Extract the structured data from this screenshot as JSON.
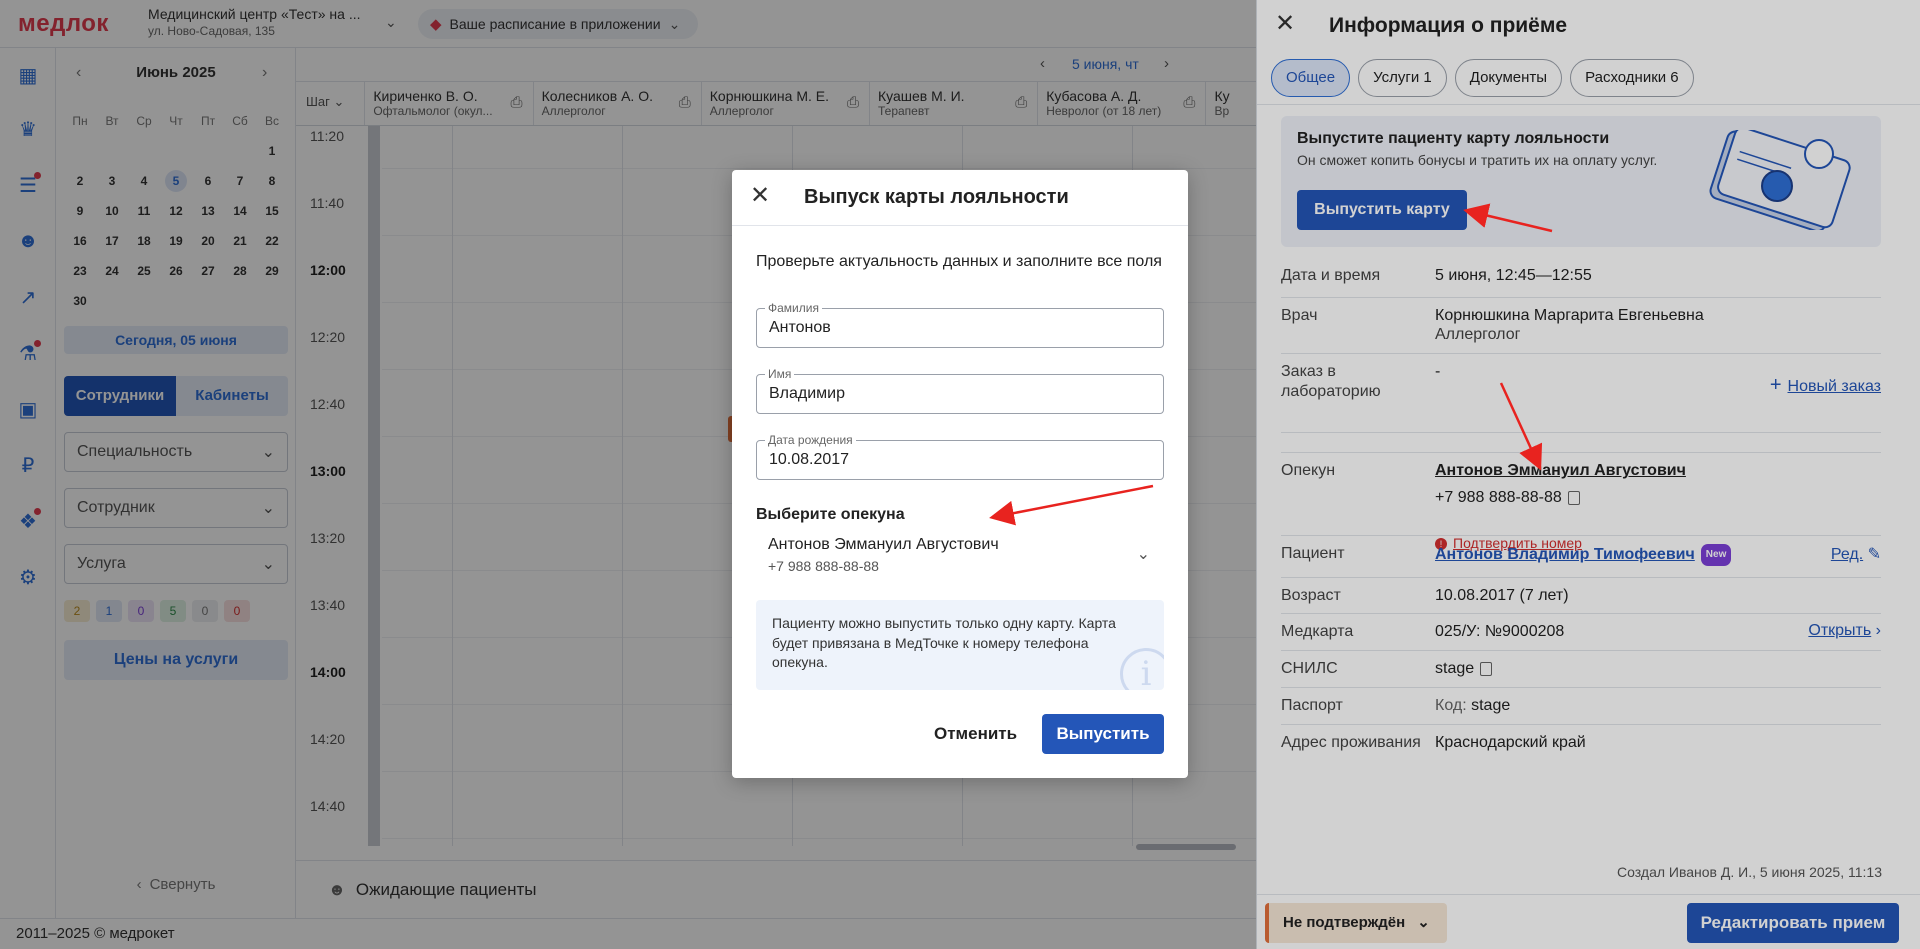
{
  "topbar": {
    "logo": "медлок",
    "clinic_name": "Медицинский центр «Тест» на ...",
    "clinic_address": "ул. Ново-Садовая, 135",
    "promo": "Ваше расписание в приложении"
  },
  "calendar": {
    "month": "Июнь 2025",
    "weekdays": [
      "Пн",
      "Вт",
      "Ср",
      "Чт",
      "Пт",
      "Сб",
      "Вс"
    ],
    "days": [
      "",
      "",
      "",
      "",
      "",
      "",
      "1",
      "2",
      "3",
      "4",
      "5",
      "6",
      "7",
      "8",
      "9",
      "10",
      "11",
      "12",
      "13",
      "14",
      "15",
      "16",
      "17",
      "18",
      "19",
      "20",
      "21",
      "22",
      "23",
      "24",
      "25",
      "26",
      "27",
      "28",
      "29",
      "30"
    ],
    "selected_day": "5",
    "today_button": "Сегодня, 05 июня",
    "tab_staff": "Сотрудники",
    "tab_rooms": "Кабинеты",
    "filter_specialty": "Специальность",
    "filter_employee": "Сотрудник",
    "filter_service": "Услуга",
    "counters": [
      {
        "value": "2",
        "bg": "#f6ecd3",
        "color": "#b98a1e"
      },
      {
        "value": "1",
        "bg": "#e2e9f7",
        "color": "#2f6fd6"
      },
      {
        "value": "0",
        "bg": "#ece4f7",
        "color": "#7b3fd6"
      },
      {
        "value": "5",
        "bg": "#dff1e3",
        "color": "#2e8b4a"
      },
      {
        "value": "0",
        "bg": "#eceef1",
        "color": "#777777"
      },
      {
        "value": "0",
        "bg": "#f9e1e1",
        "color": "#d32f2f"
      }
    ],
    "prices_button": "Цены на услуги",
    "collapse": "Свернуть"
  },
  "schedule": {
    "date": "5 июня, чт",
    "step": "Шаг",
    "doctors": [
      {
        "name": "Кириченко В. О.",
        "spec": "Офтальмолог (окул..."
      },
      {
        "name": "Колесников А. О.",
        "spec": "Аллерголог"
      },
      {
        "name": "Корнюшкина М. Е.",
        "spec": "Аллерголог"
      },
      {
        "name": "Куашев М. И.",
        "spec": "Терапевт"
      },
      {
        "name": "Кубасова А. Д.",
        "spec": "Невролог (от 18 лет)"
      },
      {
        "name": "Ку",
        "spec": "Вр"
      }
    ],
    "times": [
      {
        "t": "11:20",
        "bold": false
      },
      {
        "t": "11:40",
        "bold": false
      },
      {
        "t": "12:00",
        "bold": true
      },
      {
        "t": "12:20",
        "bold": false
      },
      {
        "t": "12:40",
        "bold": false
      },
      {
        "t": "13:00",
        "bold": true
      },
      {
        "t": "13:20",
        "bold": false
      },
      {
        "t": "13:40",
        "bold": false
      },
      {
        "t": "14:00",
        "bold": true
      },
      {
        "t": "14:20",
        "bold": false
      },
      {
        "t": "14:40",
        "bold": false
      }
    ],
    "waiting": "Ожидающие пациенты"
  },
  "footer": "2011–2025 © медрокет",
  "modal": {
    "title": "Выпуск карты лояльности",
    "subtitle": "Проверьте актуальность данных и заполните все поля",
    "surname_label": "Фамилия",
    "surname": "Антонов",
    "name_label": "Имя",
    "name": "Владимир",
    "birth_label": "Дата рождения",
    "birth": "10.08.2017",
    "guardian_title": "Выберите опекуна",
    "guardian_name": "Антонов Эммануил Августович",
    "guardian_phone": "+7 988 888-88-88",
    "info": "Пациенту можно выпустить только одну карту. Карта будет привязана в МедТочке к номеру телефона опекуна.",
    "cancel": "Отменить",
    "issue": "Выпустить"
  },
  "drawer": {
    "title": "Информация о приёме",
    "tabs": [
      "Общее",
      "Услуги 1",
      "Документы",
      "Расходники 6"
    ],
    "loyalty_title": "Выпустите пациенту карту лояльности",
    "loyalty_sub": "Он сможет копить бонусы и тратить их на оплату услуг.",
    "loyalty_button": "Выпустить карту",
    "date_label": "Дата и время",
    "date_value": "5 июня, 12:45—12:55",
    "doctor_label": "Врач",
    "doctor_name": "Корнюшкина Маргарита Евгеньевна",
    "doctor_spec": "Аллерголог",
    "lab_label": "Заказ в лабораторию",
    "lab_value": "-",
    "new_order": "Новый заказ",
    "guardian_label": "Опекун",
    "guardian_name": "Антонов Эммануил Августович",
    "guardian_phone": "+7 988 888-88-88",
    "confirm_phone": "Подтвердить номер",
    "patient_label": "Пациент",
    "patient_name": "Антонов Владимир Тимофеевич",
    "new_badge": "New",
    "edit_link": "Ред.",
    "age_label": "Возраст",
    "age_value": "10.08.2017 (7 лет)",
    "card_label": "Медкарта",
    "card_value": "025/У: №9000208",
    "open_link": "Открыть",
    "snils_label": "СНИЛС",
    "snils_value": "stage",
    "passport_label": "Паспорт",
    "passport_code": "Код:",
    "passport_value": "stage",
    "address_label": "Адрес проживания",
    "address_value": "Краснодарский край",
    "created": "Создал Иванов Д. И., 5 июня 2025, 11:13",
    "status": "Не подтверждён",
    "edit_button": "Редактировать прием"
  },
  "colors": {
    "primary": "#2456b8",
    "accent_red": "#e23b4e",
    "annotation_arrow": "#e8231f"
  }
}
